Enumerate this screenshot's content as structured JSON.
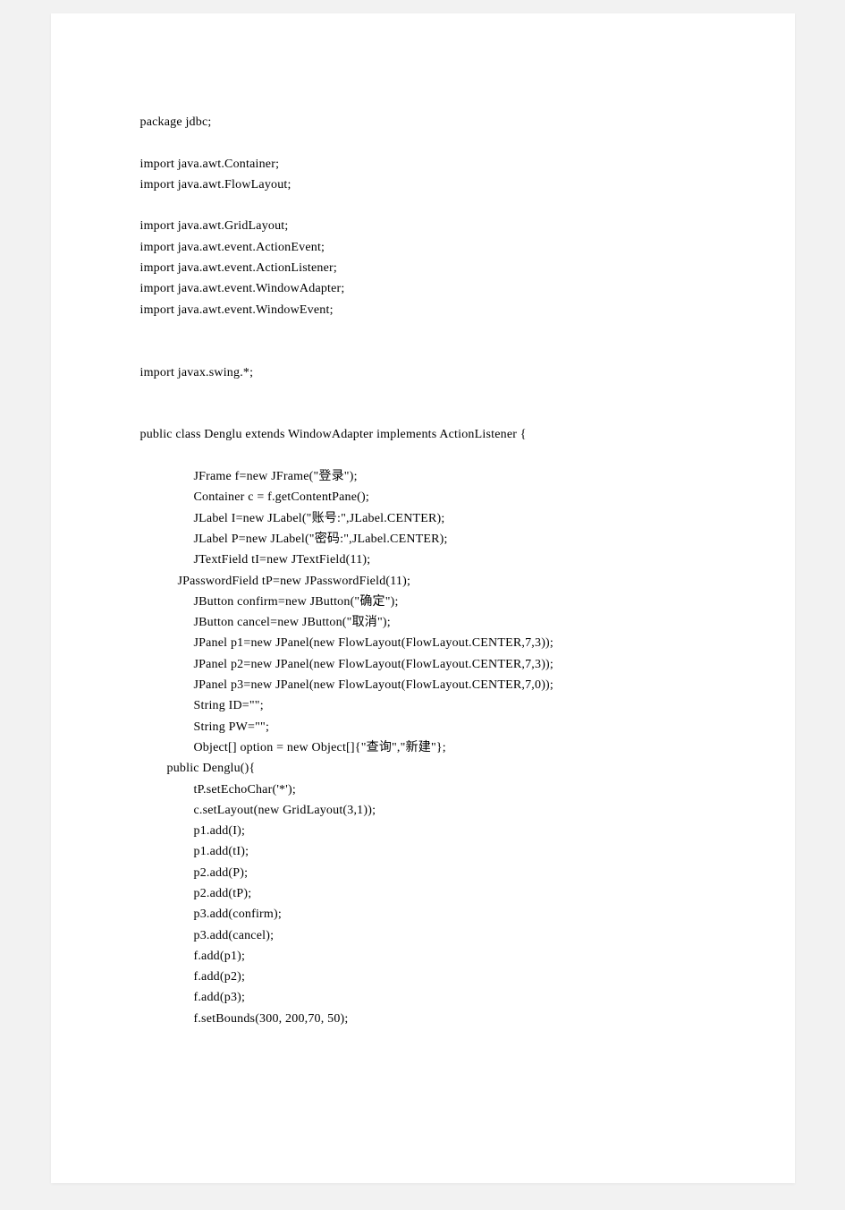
{
  "lines": [
    {
      "text": "package jdbc;",
      "cls": ""
    },
    {
      "blank": true
    },
    {
      "text": "import java.awt.Container;",
      "cls": ""
    },
    {
      "text": "import java.awt.FlowLayout;",
      "cls": ""
    },
    {
      "blank": true
    },
    {
      "text": "import java.awt.GridLayout;",
      "cls": ""
    },
    {
      "text": "import java.awt.event.ActionEvent;",
      "cls": ""
    },
    {
      "text": "import java.awt.event.ActionListener;",
      "cls": ""
    },
    {
      "text": "import java.awt.event.WindowAdapter;",
      "cls": ""
    },
    {
      "text": "import java.awt.event.WindowEvent;",
      "cls": ""
    },
    {
      "blank": true
    },
    {
      "blank": true
    },
    {
      "text": "import javax.swing.*;",
      "cls": ""
    },
    {
      "blank": true
    },
    {
      "blank": true
    },
    {
      "text": "public class Denglu extends WindowAdapter implements ActionListener {",
      "cls": ""
    },
    {
      "blank": true
    },
    {
      "text": "JFrame f=new JFrame(\"登录\");",
      "cls": "indent1"
    },
    {
      "text": "Container c = f.getContentPane();",
      "cls": "indent1"
    },
    {
      "text": "JLabel I=new JLabel(\"账号:\",JLabel.CENTER);",
      "cls": "indent1"
    },
    {
      "text": "JLabel P=new JLabel(\"密码:\",JLabel.CENTER);",
      "cls": "indent1"
    },
    {
      "text": "JTextField tI=new JTextField(11);",
      "cls": "indent1"
    },
    {
      "text": "JPasswordField tP=new JPasswordField(11);",
      "cls": "indent-half"
    },
    {
      "text": "JButton confirm=new JButton(\"确定\");",
      "cls": "indent1"
    },
    {
      "text": "JButton cancel=new JButton(\"取消\");",
      "cls": "indent1"
    },
    {
      "text": "JPanel p1=new JPanel(new FlowLayout(FlowLayout.CENTER,7,3));",
      "cls": "indent1"
    },
    {
      "text": "JPanel p2=new JPanel(new FlowLayout(FlowLayout.CENTER,7,3));",
      "cls": "indent1"
    },
    {
      "text": "JPanel p3=new JPanel(new FlowLayout(FlowLayout.CENTER,7,0));",
      "cls": "indent1"
    },
    {
      "text": "String ID=\"\";",
      "cls": "indent1"
    },
    {
      "text": "String PW=\"\";",
      "cls": "indent1"
    },
    {
      "text": "Object[] option = new Object[]{\"查询\",\"新建\"};",
      "cls": "indent1"
    },
    {
      "text": "public Denglu(){",
      "cls": "indent2"
    },
    {
      "text": "tP.setEchoChar('*');",
      "cls": "indent1"
    },
    {
      "text": "c.setLayout(new GridLayout(3,1));",
      "cls": "indent1"
    },
    {
      "text": "p1.add(I);",
      "cls": "indent1"
    },
    {
      "text": "p1.add(tI);",
      "cls": "indent1"
    },
    {
      "text": "p2.add(P);",
      "cls": "indent1"
    },
    {
      "text": "p2.add(tP);",
      "cls": "indent1"
    },
    {
      "text": "p3.add(confirm);",
      "cls": "indent1"
    },
    {
      "text": "p3.add(cancel);",
      "cls": "indent1"
    },
    {
      "text": "f.add(p1);",
      "cls": "indent1"
    },
    {
      "text": "f.add(p2);",
      "cls": "indent1"
    },
    {
      "text": "f.add(p3);",
      "cls": "indent1"
    },
    {
      "text": "f.setBounds(300, 200,70, 50);",
      "cls": "indent1"
    }
  ]
}
